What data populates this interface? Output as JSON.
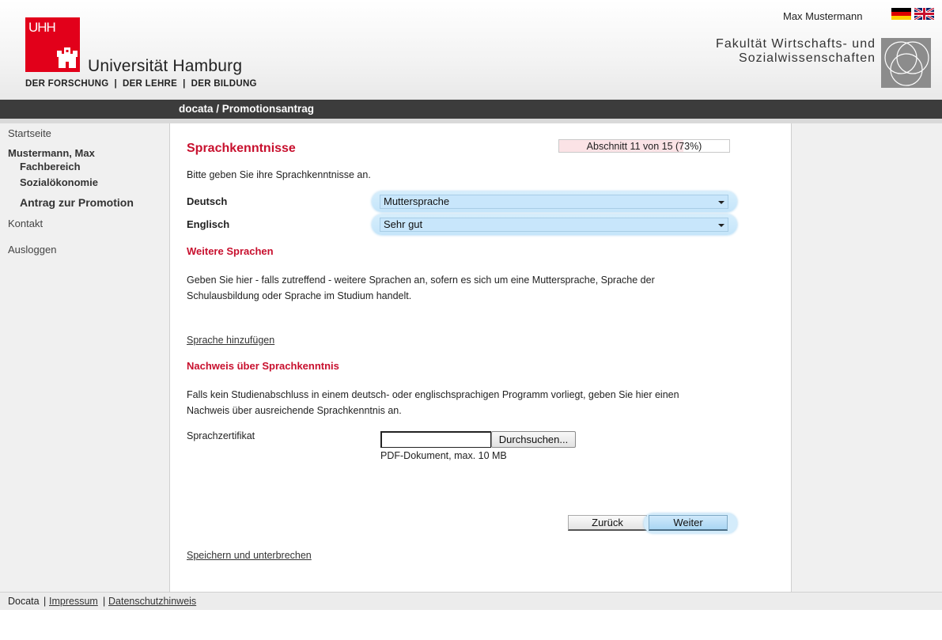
{
  "header": {
    "logo_letters": "UHH",
    "university_name": "Universität Hamburg",
    "motto": "DER FORSCHUNG  |  DER LEHRE  |  DER BILDUNG",
    "user_name": "Max Mustermann",
    "faculty_line1": "Fakultät Wirtschafts- und",
    "faculty_line2": "Sozialwissenschaften"
  },
  "titlebar": {
    "title": "docata / Promotionsantrag"
  },
  "sidebar": {
    "home": "Startseite",
    "person": "Mustermann, Max",
    "department_label": "Fachbereich",
    "department": "Sozialökonomie",
    "application": "Antrag zur Promotion",
    "contact": "Kontakt",
    "logout": "Ausloggen"
  },
  "main": {
    "title": "Sprachkenntnisse",
    "progress": {
      "text": "Abschnitt 11 von 15 (73%)",
      "fraction": 0.73
    },
    "intro": "Bitte geben Sie ihre Sprachkenntnisse an.",
    "languages": [
      {
        "label": "Deutsch",
        "value": "Muttersprache"
      },
      {
        "label": "Englisch",
        "value": "Sehr gut"
      }
    ],
    "more_languages": {
      "heading": "Weitere Sprachen",
      "text_line1": "Geben Sie hier - falls zutreffend - weitere Sprachen an, sofern es sich um eine Muttersprache, Sprache der",
      "text_line2": "Schulausbildung oder Sprache im Studium handelt.",
      "add_link": "Sprache hinzufügen"
    },
    "proof": {
      "heading": "Nachweis über Sprachkenntnis",
      "text_line1": "Falls kein Studienabschluss in einem deutsch- oder englischsprachigen Programm vorliegt, geben Sie hier einen",
      "text_line2": "Nachweis über ausreichende Sprachkenntnis an.",
      "field_label": "Sprachzertifikat",
      "file_value": "",
      "browse_button": "Durchsuchen...",
      "hint": "PDF-Dokument, max. 10 MB"
    },
    "buttons": {
      "back": "Zurück",
      "next": "Weiter"
    },
    "save_link": "Speichern und unterbrechen"
  },
  "footer": {
    "brand": "Docata",
    "separator": "|",
    "imprint": "Impressum",
    "privacy": "Datenschutzhinweis"
  },
  "colors": {
    "accent_red": "#c8102e",
    "uhh_red": "#e2001a",
    "select_blue": "#c8e6fb",
    "bar_dark": "#3c3c3c"
  }
}
